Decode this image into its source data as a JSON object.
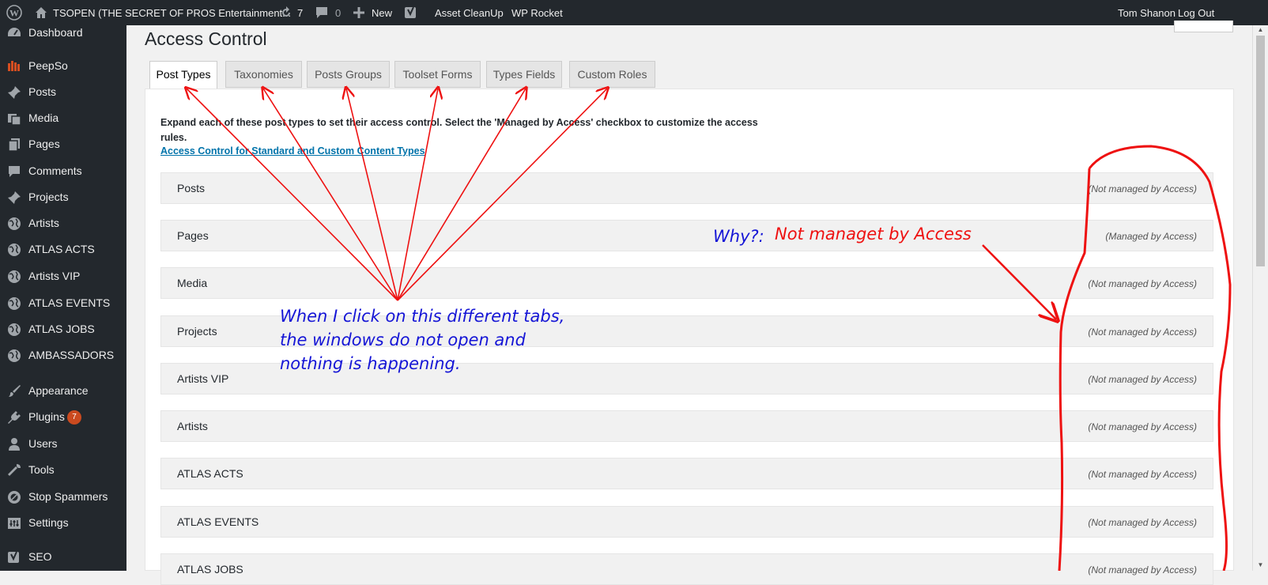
{
  "adminbar": {
    "site_name": "TSOPEN (THE SECRET OF PROS Entertainment...",
    "updates_count": "7",
    "comments_count": "0",
    "new_label": "New",
    "asset_cleanup": "Asset CleanUp",
    "wp_rocket": "WP Rocket",
    "user": "Tom Shanon",
    "logout": "Log Out"
  },
  "sidebar": {
    "items": [
      {
        "label": "Dashboard",
        "icon": "dashboard-icon"
      },
      {
        "label": "PeepSo",
        "icon": "peepso-icon"
      },
      {
        "label": "Posts",
        "icon": "pin-icon"
      },
      {
        "label": "Media",
        "icon": "media-icon"
      },
      {
        "label": "Pages",
        "icon": "pages-icon"
      },
      {
        "label": "Comments",
        "icon": "comment-icon"
      },
      {
        "label": "Projects",
        "icon": "pin-icon"
      },
      {
        "label": "Artists",
        "icon": "globe-icon"
      },
      {
        "label": "ATLAS ACTS",
        "icon": "globe-icon"
      },
      {
        "label": "Artists VIP",
        "icon": "globe-icon"
      },
      {
        "label": "ATLAS EVENTS",
        "icon": "globe-icon"
      },
      {
        "label": "ATLAS JOBS",
        "icon": "globe-icon"
      },
      {
        "label": "AMBASSADORS",
        "icon": "globe-icon"
      },
      {
        "label": "Appearance",
        "icon": "brush-icon"
      },
      {
        "label": "Plugins",
        "icon": "plug-icon",
        "badge": "7"
      },
      {
        "label": "Users",
        "icon": "user-icon"
      },
      {
        "label": "Tools",
        "icon": "wrench-icon"
      },
      {
        "label": "Stop Spammers",
        "icon": "shield-icon"
      },
      {
        "label": "Settings",
        "icon": "settings-icon"
      },
      {
        "label": "SEO",
        "icon": "seo-icon"
      }
    ]
  },
  "page": {
    "title": "Access Control",
    "tabs": [
      "Post Types",
      "Taxonomies",
      "Posts Groups",
      "Toolset Forms",
      "Types Fields",
      "Custom Roles"
    ],
    "active_tab": "Post Types",
    "intro": "Expand each of these post types to set their access control. Select the 'Managed by Access' checkbox to customize the access rules.",
    "doc_link": "Access Control for Standard and Custom Content Types",
    "rows": [
      {
        "title": "Posts",
        "status": "(Not managed by Access)"
      },
      {
        "title": "Pages",
        "status": "(Managed by Access)"
      },
      {
        "title": "Media",
        "status": "(Not managed by Access)"
      },
      {
        "title": "Projects",
        "status": "(Not managed by Access)"
      },
      {
        "title": "Artists VIP",
        "status": "(Not managed by Access)"
      },
      {
        "title": "Artists",
        "status": "(Not managed by Access)"
      },
      {
        "title": "ATLAS ACTS",
        "status": "(Not managed by Access)"
      },
      {
        "title": "ATLAS EVENTS",
        "status": "(Not managed by Access)"
      },
      {
        "title": "ATLAS JOBS",
        "status": "(Not managed by Access)"
      }
    ]
  },
  "annotations": {
    "tabs_note": [
      "When I click on this different tabs,",
      "the windows do not open and",
      "nothing is happening."
    ],
    "why_prefix": "Why?:",
    "why_text": "Not managet by Access"
  },
  "colors": {
    "adminbar_bg": "#23282d",
    "link": "#0073aa",
    "annotation_red": "#ee1111",
    "annotation_blue": "#1515d6",
    "badge": "#ca4a1f"
  }
}
